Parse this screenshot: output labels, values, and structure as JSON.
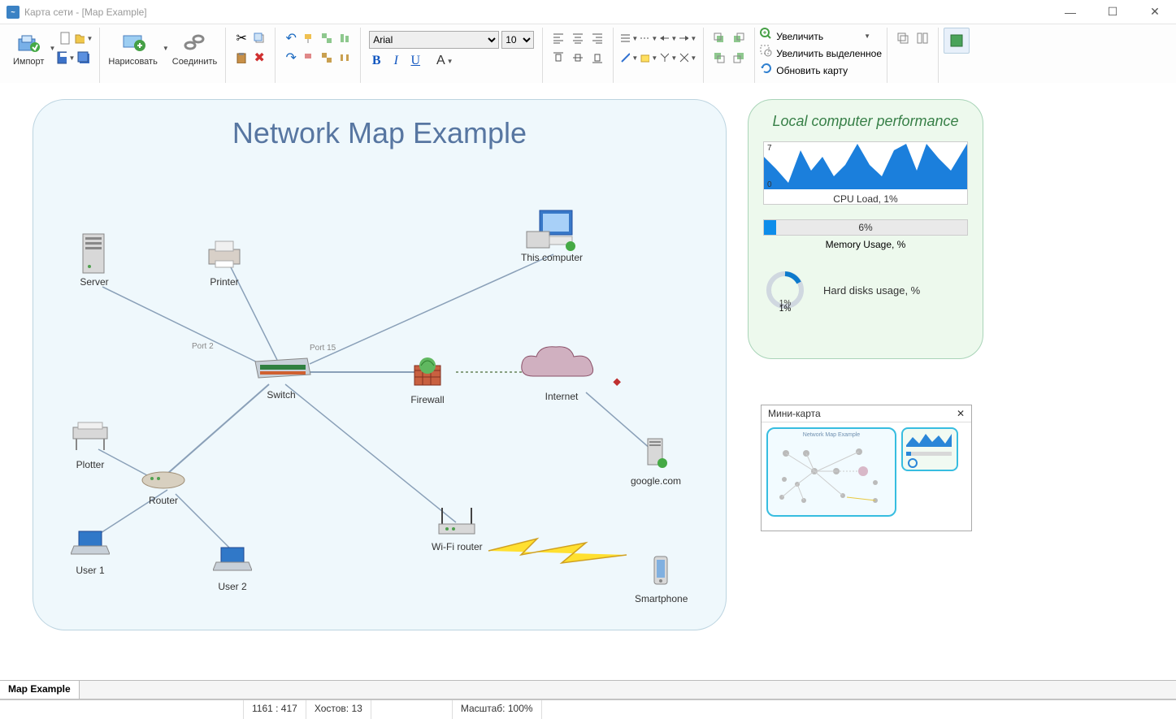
{
  "window": {
    "title": "Карта сети - [Map Example]"
  },
  "toolbar": {
    "import": "Импорт",
    "draw": "Нарисовать",
    "connect": "Соединить",
    "font": "Arial",
    "font_size": "10",
    "zoom_in": "Увеличить",
    "zoom_selection": "Увеличить выделенное",
    "refresh_map": "Обновить карту"
  },
  "map": {
    "title": "Network Map Example",
    "nodes": {
      "server": "Server",
      "printer": "Printer",
      "this_computer": "This computer",
      "switch": "Switch",
      "firewall": "Firewall",
      "internet": "Internet",
      "plotter": "Plotter",
      "router": "Router",
      "google": "google.com",
      "user1": "User 1",
      "user2": "User 2",
      "wifi": "Wi-Fi router",
      "smartphone": "Smartphone"
    },
    "edges": {
      "port2": "Port 2",
      "port15": "Port 15"
    }
  },
  "perf": {
    "title": "Local computer performance",
    "cpu_label": "CPU Load, 1%",
    "cpu_ymax": "7",
    "cpu_ymin": "0",
    "mem_val": "6%",
    "mem_label": "Memory Usage, %",
    "disk_val": "1%",
    "disk_label": "Hard disks usage, %"
  },
  "chart_data": {
    "type": "area",
    "title": "CPU Load, 1%",
    "ylabel": "",
    "ylim": [
      0,
      7
    ],
    "x": [
      0,
      1,
      2,
      3,
      4,
      5,
      6,
      7,
      8,
      9,
      10,
      11,
      12,
      13,
      14,
      15,
      16,
      17
    ],
    "values": [
      5,
      3,
      1,
      6,
      3,
      5,
      2,
      4,
      7,
      4,
      2,
      6,
      7,
      3,
      7,
      5,
      3,
      7
    ]
  },
  "minimap": {
    "title": "Мини-карта"
  },
  "tabs": {
    "active": "Map Example"
  },
  "status": {
    "coords": "1161 : 417",
    "hosts_label": "Хостов:",
    "hosts_val": "13",
    "scale_label": "Масштаб:",
    "scale_val": "100%"
  }
}
